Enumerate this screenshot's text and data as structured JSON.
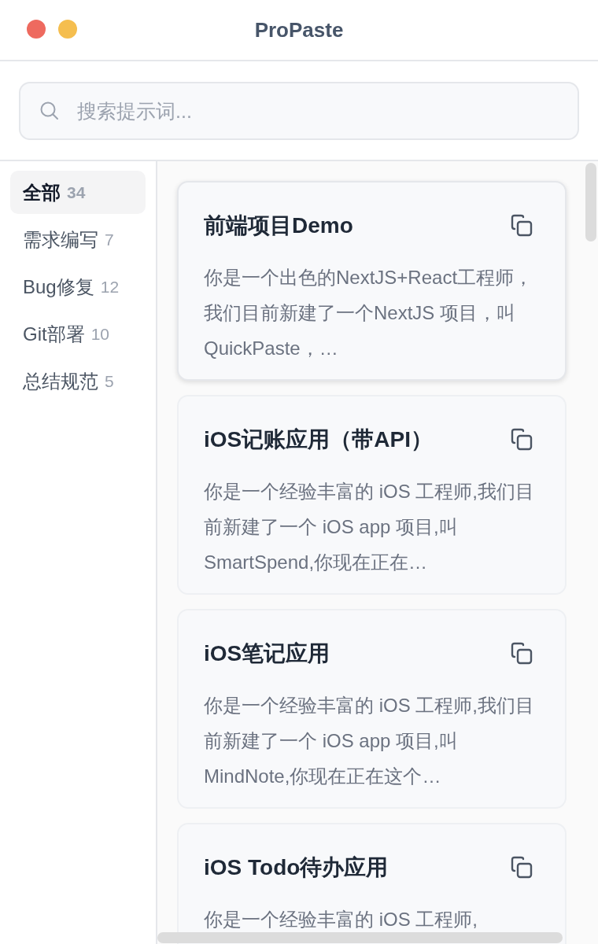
{
  "window": {
    "title": "ProPaste",
    "controls": [
      {
        "color": "#ee6a5f"
      },
      {
        "color": "#f5be4f"
      }
    ]
  },
  "search": {
    "placeholder": "搜索提示词..."
  },
  "sidebar": {
    "items": [
      {
        "label": "全部",
        "count": "34",
        "selected": true
      },
      {
        "label": "需求编写",
        "count": "7",
        "selected": false
      },
      {
        "label": "Bug修复",
        "count": "12",
        "selected": false
      },
      {
        "label": "Git部署",
        "count": "10",
        "selected": false
      },
      {
        "label": "总结规范",
        "count": "5",
        "selected": false
      }
    ]
  },
  "cards": [
    {
      "title": "前端项目Demo",
      "preview": "你是一个出色的NextJS+React工程师，我们目前新建了一个NextJS 项目，叫QuickPaste，…",
      "selected": true
    },
    {
      "title": "iOS记账应用（带API）",
      "preview": "你是一个经验丰富的 iOS 工程师,我们目前新建了一个 iOS app 项目,叫 SmartSpend,你现在正在…",
      "selected": false
    },
    {
      "title": "iOS笔记应用",
      "preview": "你是一个经验丰富的 iOS 工程师,我们目前新建了一个 iOS app 项目,叫 MindNote,你现在正在这个…",
      "selected": false
    },
    {
      "title": "iOS Todo待办应用",
      "preview": "你是一个经验丰富的 iOS 工程师,",
      "selected": false
    }
  ]
}
